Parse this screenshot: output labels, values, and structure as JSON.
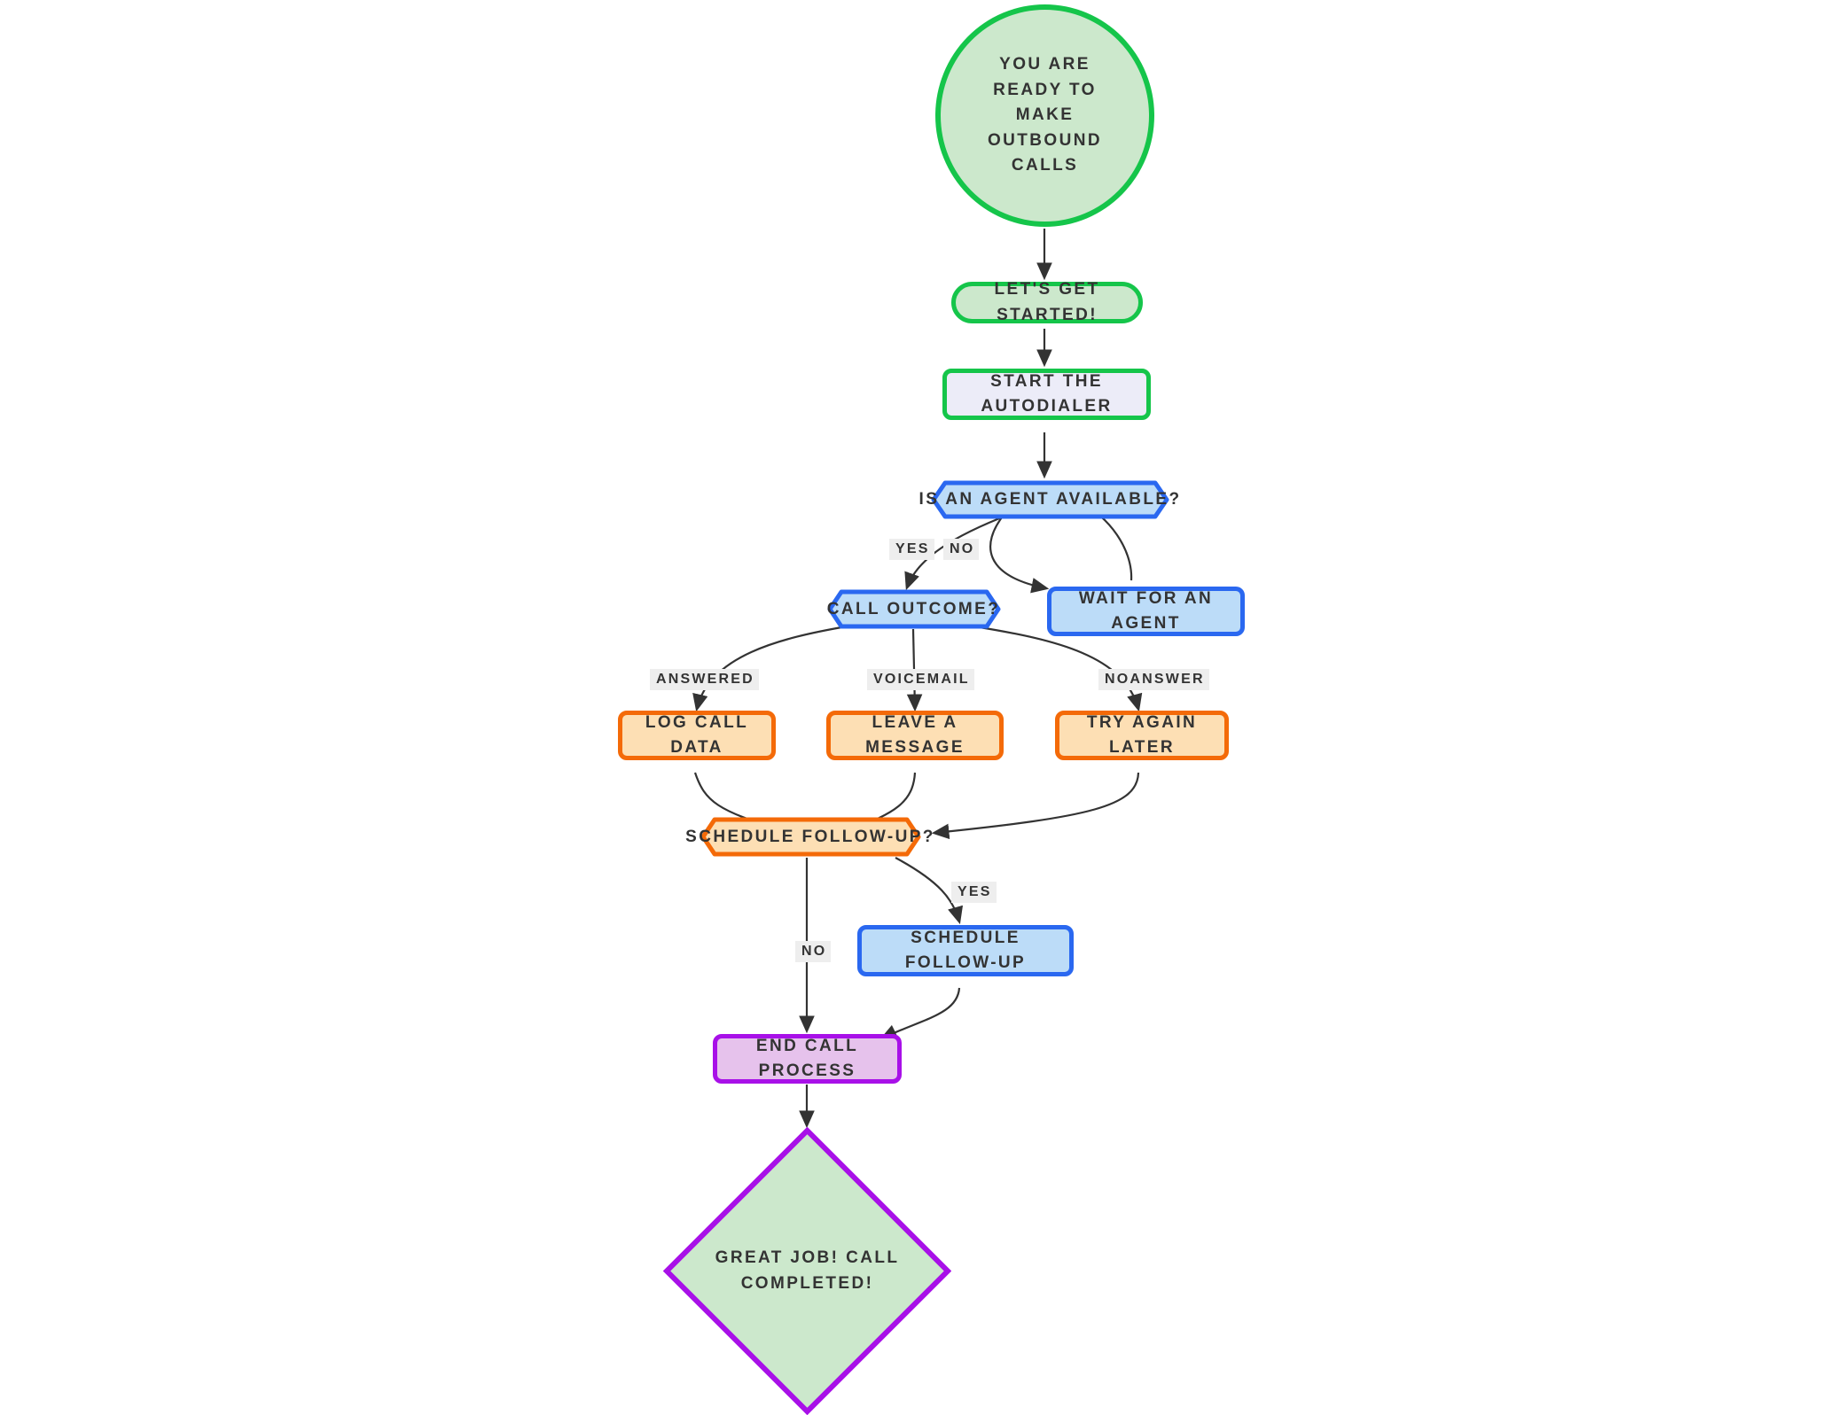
{
  "diagram": {
    "title": "Outbound Call Autodialer Flowchart",
    "background": "#ffffff",
    "edge_color": "#333333"
  },
  "palette": {
    "green_border": "#15c54a",
    "green_fill": "#cce8cc",
    "lavender_fill": "#ececf8",
    "blue_border": "#2a68f0",
    "blue_fill": "#bcdcf8",
    "orange_border": "#f46a08",
    "orange_fill": "#fddfb4",
    "purple_border": "#a810e8",
    "purple_fill": "#e6c2ec",
    "label_bg": "#eeeeee",
    "text": "#333333"
  },
  "nodes": {
    "start_circle": {
      "label": "YOU ARE READY TO MAKE OUTBOUND CALLS",
      "shape": "circle"
    },
    "lets_get_started": {
      "label": "LET'S GET STARTED!",
      "shape": "stadium"
    },
    "start_autodialer": {
      "label": "START THE AUTODIALER",
      "shape": "rect"
    },
    "agent_available": {
      "label": "IS AN AGENT AVAILABLE?",
      "shape": "hexagon"
    },
    "wait_for_agent": {
      "label": "WAIT FOR AN AGENT",
      "shape": "rect"
    },
    "call_outcome": {
      "label": "CALL OUTCOME?",
      "shape": "hexagon"
    },
    "log_call_data": {
      "label": "LOG CALL DATA",
      "shape": "rect"
    },
    "leave_a_message": {
      "label": "LEAVE A MESSAGE",
      "shape": "rect"
    },
    "try_again_later": {
      "label": "TRY AGAIN LATER",
      "shape": "rect"
    },
    "schedule_followup_q": {
      "label": "SCHEDULE FOLLOW-UP?",
      "shape": "hexagon"
    },
    "schedule_followup": {
      "label": "SCHEDULE FOLLOW-UP",
      "shape": "rect"
    },
    "end_call_process": {
      "label": "END CALL PROCESS",
      "shape": "rect"
    },
    "great_job": {
      "label": "GREAT JOB! CALL COMPLETED!",
      "shape": "diamond",
      "line1": "GREAT JOB! CALL",
      "line2": "COMPLETED!"
    }
  },
  "edge_labels": {
    "yes_agent": "YES",
    "no_agent": "NO",
    "answered": "ANSWERED",
    "voicemail": "VOICEMAIL",
    "noanswer": "NOANSWER",
    "followup_yes": "YES",
    "followup_no": "NO"
  },
  "edges": [
    {
      "from": "start_circle",
      "to": "lets_get_started",
      "label": ""
    },
    {
      "from": "lets_get_started",
      "to": "start_autodialer",
      "label": ""
    },
    {
      "from": "start_autodialer",
      "to": "agent_available",
      "label": ""
    },
    {
      "from": "agent_available",
      "to": "call_outcome",
      "label": "YES"
    },
    {
      "from": "agent_available",
      "to": "wait_for_agent",
      "label": "NO"
    },
    {
      "from": "wait_for_agent",
      "to": "agent_available",
      "label": ""
    },
    {
      "from": "call_outcome",
      "to": "log_call_data",
      "label": "ANSWERED"
    },
    {
      "from": "call_outcome",
      "to": "leave_a_message",
      "label": "VOICEMAIL"
    },
    {
      "from": "call_outcome",
      "to": "try_again_later",
      "label": "NOANSWER"
    },
    {
      "from": "log_call_data",
      "to": "schedule_followup_q",
      "label": ""
    },
    {
      "from": "leave_a_message",
      "to": "schedule_followup_q",
      "label": ""
    },
    {
      "from": "try_again_later",
      "to": "schedule_followup_q",
      "label": ""
    },
    {
      "from": "schedule_followup_q",
      "to": "schedule_followup",
      "label": "YES"
    },
    {
      "from": "schedule_followup_q",
      "to": "end_call_process",
      "label": "NO"
    },
    {
      "from": "schedule_followup",
      "to": "end_call_process",
      "label": ""
    },
    {
      "from": "end_call_process",
      "to": "great_job",
      "label": ""
    }
  ]
}
